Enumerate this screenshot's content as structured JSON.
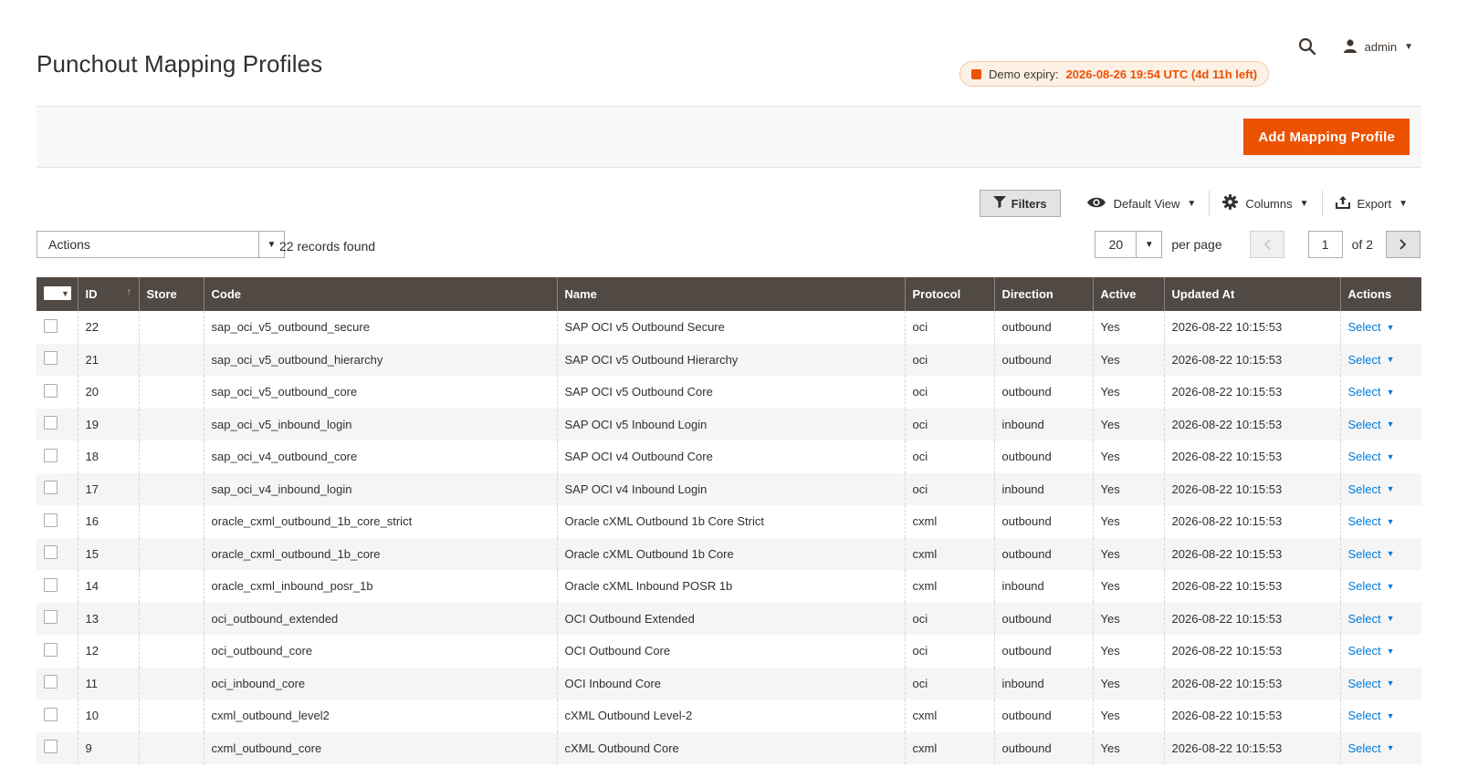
{
  "page": {
    "title": "Punchout Mapping Profiles"
  },
  "header": {
    "user": "admin"
  },
  "demo": {
    "label": "Demo expiry:",
    "value": "2026-08-26 19:54 UTC (4d 11h left)"
  },
  "actions": {
    "add_label": "Add Mapping Profile"
  },
  "toolbar": {
    "filters": "Filters",
    "view": "Default View",
    "columns": "Columns",
    "export": "Export"
  },
  "grid": {
    "mass_action": "Actions",
    "records": "22 records found",
    "per_page": "20",
    "per_page_label": "per page",
    "current_page": "1",
    "total_pages_label": "of 2",
    "columns": [
      "ID",
      "Store",
      "Code",
      "Name",
      "Protocol",
      "Direction",
      "Active",
      "Updated At",
      "Actions"
    ],
    "row_action": "Select",
    "rows": [
      {
        "id": "22",
        "store": "",
        "code": "sap_oci_v5_outbound_secure",
        "name": "SAP OCI v5 Outbound Secure",
        "protocol": "oci",
        "direction": "outbound",
        "active": "Yes",
        "updated": "2026-08-22 10:15:53"
      },
      {
        "id": "21",
        "store": "",
        "code": "sap_oci_v5_outbound_hierarchy",
        "name": "SAP OCI v5 Outbound Hierarchy",
        "protocol": "oci",
        "direction": "outbound",
        "active": "Yes",
        "updated": "2026-08-22 10:15:53"
      },
      {
        "id": "20",
        "store": "",
        "code": "sap_oci_v5_outbound_core",
        "name": "SAP OCI v5 Outbound Core",
        "protocol": "oci",
        "direction": "outbound",
        "active": "Yes",
        "updated": "2026-08-22 10:15:53"
      },
      {
        "id": "19",
        "store": "",
        "code": "sap_oci_v5_inbound_login",
        "name": "SAP OCI v5 Inbound Login",
        "protocol": "oci",
        "direction": "inbound",
        "active": "Yes",
        "updated": "2026-08-22 10:15:53"
      },
      {
        "id": "18",
        "store": "",
        "code": "sap_oci_v4_outbound_core",
        "name": "SAP OCI v4 Outbound Core",
        "protocol": "oci",
        "direction": "outbound",
        "active": "Yes",
        "updated": "2026-08-22 10:15:53"
      },
      {
        "id": "17",
        "store": "",
        "code": "sap_oci_v4_inbound_login",
        "name": "SAP OCI v4 Inbound Login",
        "protocol": "oci",
        "direction": "inbound",
        "active": "Yes",
        "updated": "2026-08-22 10:15:53"
      },
      {
        "id": "16",
        "store": "",
        "code": "oracle_cxml_outbound_1b_core_strict",
        "name": "Oracle cXML Outbound 1b Core Strict",
        "protocol": "cxml",
        "direction": "outbound",
        "active": "Yes",
        "updated": "2026-08-22 10:15:53"
      },
      {
        "id": "15",
        "store": "",
        "code": "oracle_cxml_outbound_1b_core",
        "name": "Oracle cXML Outbound 1b Core",
        "protocol": "cxml",
        "direction": "outbound",
        "active": "Yes",
        "updated": "2026-08-22 10:15:53"
      },
      {
        "id": "14",
        "store": "",
        "code": "oracle_cxml_inbound_posr_1b",
        "name": "Oracle cXML Inbound POSR 1b",
        "protocol": "cxml",
        "direction": "inbound",
        "active": "Yes",
        "updated": "2026-08-22 10:15:53"
      },
      {
        "id": "13",
        "store": "",
        "code": "oci_outbound_extended",
        "name": "OCI Outbound Extended",
        "protocol": "oci",
        "direction": "outbound",
        "active": "Yes",
        "updated": "2026-08-22 10:15:53"
      },
      {
        "id": "12",
        "store": "",
        "code": "oci_outbound_core",
        "name": "OCI Outbound Core",
        "protocol": "oci",
        "direction": "outbound",
        "active": "Yes",
        "updated": "2026-08-22 10:15:53"
      },
      {
        "id": "11",
        "store": "",
        "code": "oci_inbound_core",
        "name": "OCI Inbound Core",
        "protocol": "oci",
        "direction": "inbound",
        "active": "Yes",
        "updated": "2026-08-22 10:15:53"
      },
      {
        "id": "10",
        "store": "",
        "code": "cxml_outbound_level2",
        "name": "cXML Outbound Level-2",
        "protocol": "cxml",
        "direction": "outbound",
        "active": "Yes",
        "updated": "2026-08-22 10:15:53"
      },
      {
        "id": "9",
        "store": "",
        "code": "cxml_outbound_core",
        "name": "cXML Outbound Core",
        "protocol": "cxml",
        "direction": "outbound",
        "active": "Yes",
        "updated": "2026-08-22 10:15:53"
      }
    ]
  },
  "colors": {
    "accent": "#eb5202",
    "header_bg": "#514943",
    "link": "#007bdb"
  }
}
